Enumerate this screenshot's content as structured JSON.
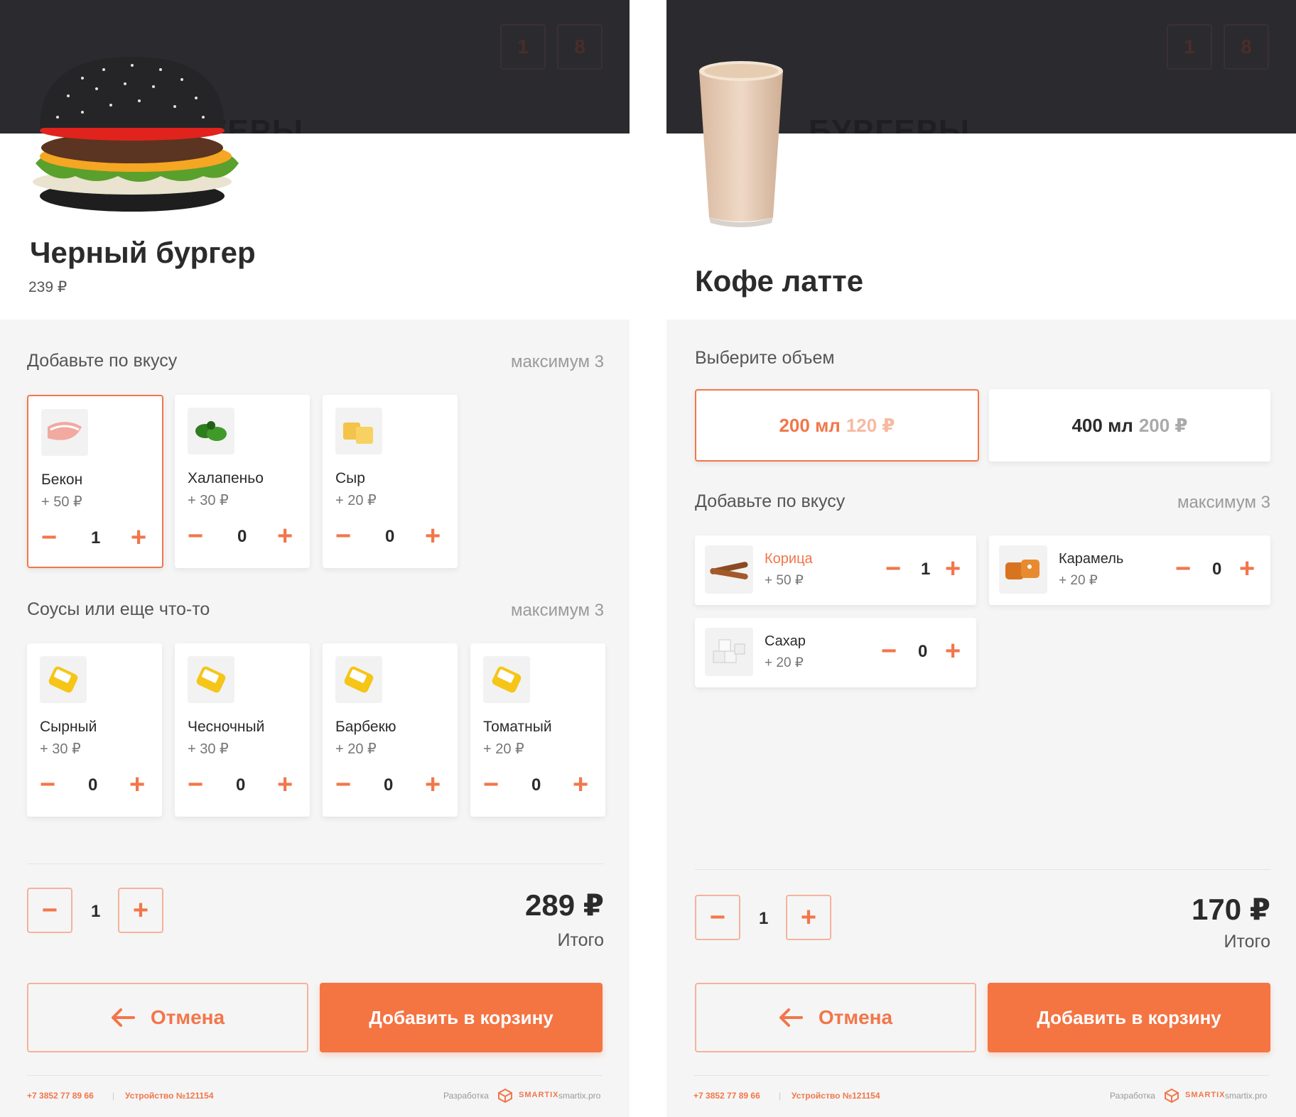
{
  "burger": {
    "header_ghost": "БУРГЕРЫ",
    "header_btn1": "1",
    "header_btn2": "8",
    "title": "Черный бургер",
    "price": "239 ₽",
    "section1": {
      "title": "Добавьте по вкусу",
      "max": "максимум 3"
    },
    "toppings": [
      {
        "name": "Бекон",
        "price": "+ 50 ₽",
        "count": "1"
      },
      {
        "name": "Халапеньо",
        "price": "+ 30 ₽",
        "count": "0"
      },
      {
        "name": "Сыр",
        "price": "+ 20 ₽",
        "count": "0"
      }
    ],
    "section2": {
      "title": "Соусы или еще что-то",
      "max": "максимум 3"
    },
    "sauces": [
      {
        "name": "Сырный",
        "price": "+ 30 ₽",
        "count": "0"
      },
      {
        "name": "Чесночный",
        "price": "+ 30 ₽",
        "count": "0"
      },
      {
        "name": "Барбекю",
        "price": "+ 20 ₽",
        "count": "0"
      },
      {
        "name": "Томатный",
        "price": "+ 20 ₽",
        "count": "0"
      }
    ],
    "quantity": "1",
    "total": "289 ₽",
    "total_label": "Итого",
    "cancel_label": "Отмена",
    "add_label": "Добавить в корзину"
  },
  "latte": {
    "header_ghost": "БУРГЕРЫ",
    "header_btn1": "1",
    "header_btn2": "8",
    "title": "Кофе латте",
    "volume_title": "Выберите объем",
    "volumes": [
      {
        "size": "200 мл",
        "price": "120 ₽"
      },
      {
        "size": "400 мл",
        "price": "200 ₽"
      }
    ],
    "section1": {
      "title": "Добавьте по вкусу",
      "max": "максимум 3"
    },
    "addons": [
      {
        "name": "Корица",
        "price": "+ 50 ₽",
        "count": "1"
      },
      {
        "name": "Карамель",
        "price": "+ 20 ₽",
        "count": "0"
      },
      {
        "name": "Сахар",
        "price": "+ 20 ₽",
        "count": "0"
      }
    ],
    "quantity": "1",
    "total": "170 ₽",
    "total_label": "Итого",
    "cancel_label": "Отмена",
    "add_label": "Добавить в корзину"
  },
  "footer": {
    "phone": "+7 3852 77 89 66",
    "separator": "|",
    "device": "Устройство №121154",
    "dev_label": "Разработка",
    "brand": "SMARTIX",
    "site": "smartix.pro"
  },
  "colors": {
    "accent": "#f47442",
    "header": "#2b2a2f",
    "panel": "#f5f5f5"
  },
  "icons": [
    "burger-image",
    "latte-image",
    "bacon-icon",
    "jalapeno-icon",
    "cheese-icon",
    "sauce-packet-icon",
    "cinnamon-icon",
    "caramel-icon",
    "sugar-icon",
    "arrow-left-icon",
    "smartix-logo-icon"
  ]
}
